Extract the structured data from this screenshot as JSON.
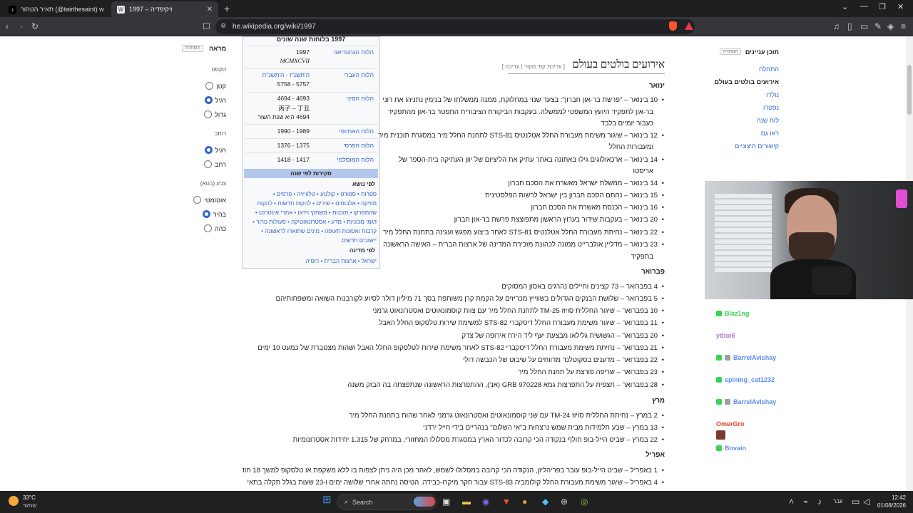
{
  "browser": {
    "tabs": [
      {
        "title": "תאיר הטהור (@tairthesaint) with os",
        "active": false
      },
      {
        "title": "1997 – ויקיפדיה",
        "active": true
      }
    ],
    "new_tab": "+",
    "url": "he.wikipedia.org/wiki/1997",
    "accent": "#fb542b"
  },
  "appearance": {
    "title": "מראה",
    "hide": "הסתרה",
    "text_label": "טקסט",
    "text_options": [
      {
        "label": "קטן",
        "selected": false
      },
      {
        "label": "רגיל",
        "selected": true
      },
      {
        "label": "גדול",
        "selected": false
      }
    ],
    "width_label": "רוחב",
    "width_options": [
      {
        "label": "רגיל",
        "selected": true
      },
      {
        "label": "רחב",
        "selected": false
      }
    ],
    "color_label": "צבע (בטא)",
    "color_options": [
      {
        "label": "אוטומטי",
        "selected": false
      },
      {
        "label": "בהיר",
        "selected": true
      },
      {
        "label": "כהה",
        "selected": false
      }
    ]
  },
  "infobox": {
    "header": "1997 בלוחות שנה שונים",
    "rows": [
      {
        "k": "הלוח הגרגוריאני",
        "v1": "1997",
        "v2": "MCMXCVII"
      },
      {
        "k": "הלוח העברי",
        "v1": "ה'תשנ\"ז - ה'תשנ\"ח",
        "v2": "5757 - 5758"
      },
      {
        "k": "הלוח הסיני",
        "v1": "4693 - 4694",
        "v2": "丙子 – 丁丑",
        "v3": "4694 היא שנת השור"
      },
      {
        "k": "הלוח האתיופי",
        "v1": "1989 - 1990"
      },
      {
        "k": "הלוח הפרסי",
        "v1": "1375 - 1376"
      },
      {
        "k": "הלוח המוסלמי",
        "v1": "1417 - 1418"
      }
    ],
    "series_title": "סקירות לפי שנה",
    "by_topic": "לפי נושא",
    "topic_lines": [
      "ספרות • ספורט • קולנוע • טלוויזיה • פרסים •",
      "מוזיקה • אלבומים • שירים • להקות חדשות • להקות",
      "שהתפרקו • תוכנות • משחקי וידאו • אתרי אינטרנט •",
      "דגמי מכוניות • מדע • אסטרונאוטיקה • פעולות טרור •",
      "קרבות ואסונות תעופה • מינים שתוארו לראשונה •",
      "יישובים חדשים"
    ],
    "by_country": "לפי מדינה",
    "country_line": "ישראל • ארצות הברית • רוסיה"
  },
  "article": {
    "title": "אירועים בולטים בעולם",
    "edit": "[ עריכת קוד מקור | עריכה ]",
    "months": {
      "jan": "ינואר",
      "feb": "פברואר",
      "mar": "מרץ",
      "apr": "אפריל"
    },
    "jan_items": [
      "10 בינואר – \"פרשת בר-און חברון\": בצעד שנוי במחלוקת, ממנה ממשלתו של בנימין נתניהו את רוני",
      "12 בינואר – שיגור משימת מעבורת החלל אטלנטיס STS-81 לתחנת החלל מיר במסגרת תוכנית מיר",
      "14 בינואר – ארכאולוגים גילו באתונה באתר עתיק את הליציום של יוון העתיקה בית-הספר של",
      "14 בינואר – ממשלת ישראל מאשרת את הסכם חברון",
      "15 בינואר – נחתם הסכם חברון בין ישראל לרשות הפלסטינית",
      "16 בינואר – הכנסת מאשרת את הסכם חברון",
      "20 בינואר – בעקבות שידור בערוץ הראשון מתפוצצת פרשת בר-און חברון",
      "22 בינואר – נחיתת מעבורת החלל אטלנטיס STS-81 לאחר ביצוע מפגש ועגינה בתחנת החלל מיר",
      "23 בינואר – מדליין אולברייט ממונה לכהונת מזכירת המדינה של ארצות הברית – האישה הראשונה"
    ],
    "jan_cont": [
      "בר-און לתפקיד היועץ המשפטי לממשלה. בעקבות הביקורת הציבורית התפטר בר-און מהתפקיד",
      "כעבור יומיים בלבד",
      "ומעבורות החלל",
      "אריסטו",
      "בתפקיד"
    ],
    "feb_items": [
      "4 בפברואר – 73 קצינים וחיילים נהרגים באסון המסוקים",
      "5 בפברואר – שלושת הבנקים הגדולים בשווייץ מכריזים על הקמת קרן משותפת בסך 71 מיליון דולר לסיוע לקורבנות השואה ומשפחותיהם",
      "10 בפברואר – שיגור החללית סויוז TM-25 לתחנת החלל מיר עם צוות קוסמונאוטים ואסטרונאוט גרמני",
      "11 בפברואר – שיגור משימת מעבורת החלל דיסקברי STS-82 למשימת שירות טלסקופ החלל האבל",
      "20 בפברואר – הגשושית גלילאו מבצעת יעף ליד הירח אירופה של צדק",
      "21 בפברואר – נחיתת משימת מעבורת החלל דיסקברי STS-82 לאחר משימת שירות לטלסקופ החלל האבל ושהות מצטברת של כמעט 10 ימים",
      "22 בפברואר – מדענים בסקוטלנד מדווחים על שיבוט של הכבשה דולי",
      "23 בפברואר – שריפה פורצת על תחנת החלל מיר",
      "28 בפברואר – תצפית על התפרצות גמא GRB 970228 (אנ'), ההתפרצות הראשונה שנתפצתה בה הבזק משנה"
    ],
    "mar_items": [
      "2 במרץ – נחיתת החללית סויוז TM-24 עם שני קוסמונאוטים ואסטרונאוט גרמני לאחר שהות בתחנת החלל מיר",
      "13 במרץ – שבע תלמידות מבית שמש נרצחות ב\"אי השלום\" בנהריים בידי חייל ירדני",
      "22 במרץ – שביט הייל-בופ חולף בנקודה הכי קרובה לכדור הארץ במסגרת מסלולו המחזורי, במרחק של 1.315 יחידות אסטרונומיות"
    ],
    "apr_items": [
      "1 באפריל – שביט הייל-בופ עובר בפריהליון, הנקודה הכי קרובה במסלולו לשמש, לאחר מכן היה ניתן לצפות בו ללא משקפת או טלסקופ למשך 18 חודש",
      "4 באפריל – שיגור משימת מעבורת החלל קולומביה STS-83 עבור חקר מיקרו-כבידה. הטיסה נחתה אחרי שלושה ימים ו-23 שעות בגלל תקלה בתאי"
    ]
  },
  "toc": {
    "title": "תוכן עניינים",
    "hide": "הסתרה",
    "items": [
      "התחלה",
      "אירועים בולטים בעולם",
      "נולדו",
      "נפטרו",
      "לוח שנה",
      "ראו גם",
      "קישורים חיצוניים"
    ]
  },
  "chat": [
    {
      "user": "Blaz1ng",
      "color": "#39d353",
      "msg": ""
    },
    {
      "user": "ytboi6",
      "color": "#b37bd6",
      "msg": ""
    },
    {
      "user": "BarrelAvishay",
      "color": "#5a8dee",
      "msg": ""
    },
    {
      "user": "spining_cat1232",
      "color": "#5a8dee",
      "msg": ""
    },
    {
      "user": "BarrelAvishay",
      "color": "#5a8dee",
      "msg": ""
    },
    {
      "user": "OmerGro",
      "color": "#d9442f",
      "msg": ""
    },
    {
      "user": "Bovain",
      "color": "#5a8dee",
      "msg": ""
    }
  ],
  "taskbar": {
    "weather_temp": "33°C",
    "weather_desc": "שמשי",
    "search": "Search",
    "lang": "עבר",
    "time": "12:42",
    "date": "01/08/2026"
  }
}
